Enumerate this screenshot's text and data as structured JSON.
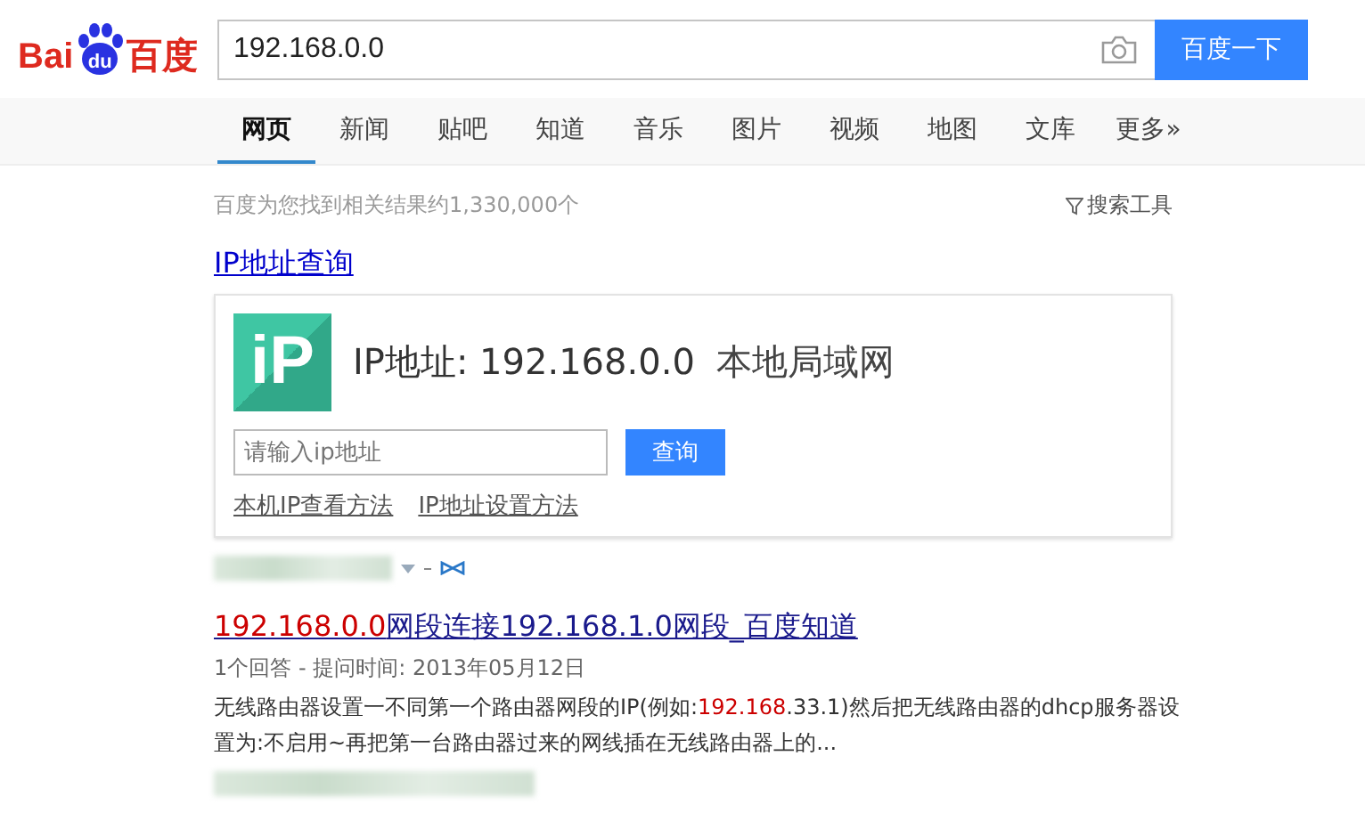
{
  "logo": {
    "left": "Bai",
    "paw": "du",
    "right": "百度"
  },
  "search": {
    "value": "192.168.0.0",
    "button": "百度一下"
  },
  "tabs": [
    {
      "label": "网页",
      "selected": true
    },
    {
      "label": "新闻",
      "selected": false
    },
    {
      "label": "贴吧",
      "selected": false
    },
    {
      "label": "知道",
      "selected": false
    },
    {
      "label": "音乐",
      "selected": false
    },
    {
      "label": "图片",
      "selected": false
    },
    {
      "label": "视频",
      "selected": false
    },
    {
      "label": "地图",
      "selected": false
    },
    {
      "label": "文库",
      "selected": false
    },
    {
      "label": "更多»",
      "selected": false
    }
  ],
  "result_count": "百度为您找到相关结果约1,330,000个",
  "search_tools": "搜索工具",
  "ip_card": {
    "title": "IP地址查询",
    "logo": "iP",
    "headline": "IP地址: 192.168.0.0",
    "region": "本地局域网",
    "placeholder": "请输入ip地址",
    "button": "查询",
    "links": [
      "本机IP查看方法",
      "IP地址设置方法"
    ]
  },
  "result": {
    "title": [
      {
        "text": "192.168.0.0",
        "highlight": true
      },
      {
        "text": "网段连接192.168.1.0网段_百度知道",
        "highlight": false
      }
    ],
    "meta": "1个回答 - 提问时间: 2013年05月12日",
    "snippet": [
      {
        "text": "无线路由器设置一不同第一个路由器网段的IP(例如:",
        "highlight": false
      },
      {
        "text": "192.168",
        "highlight": true
      },
      {
        "text": ".33.1)然后把无线路由器的dhcp服务器设置为:不启用~再把第一台路由器过来的网线插在无线路由器上的...",
        "highlight": false
      }
    ]
  }
}
